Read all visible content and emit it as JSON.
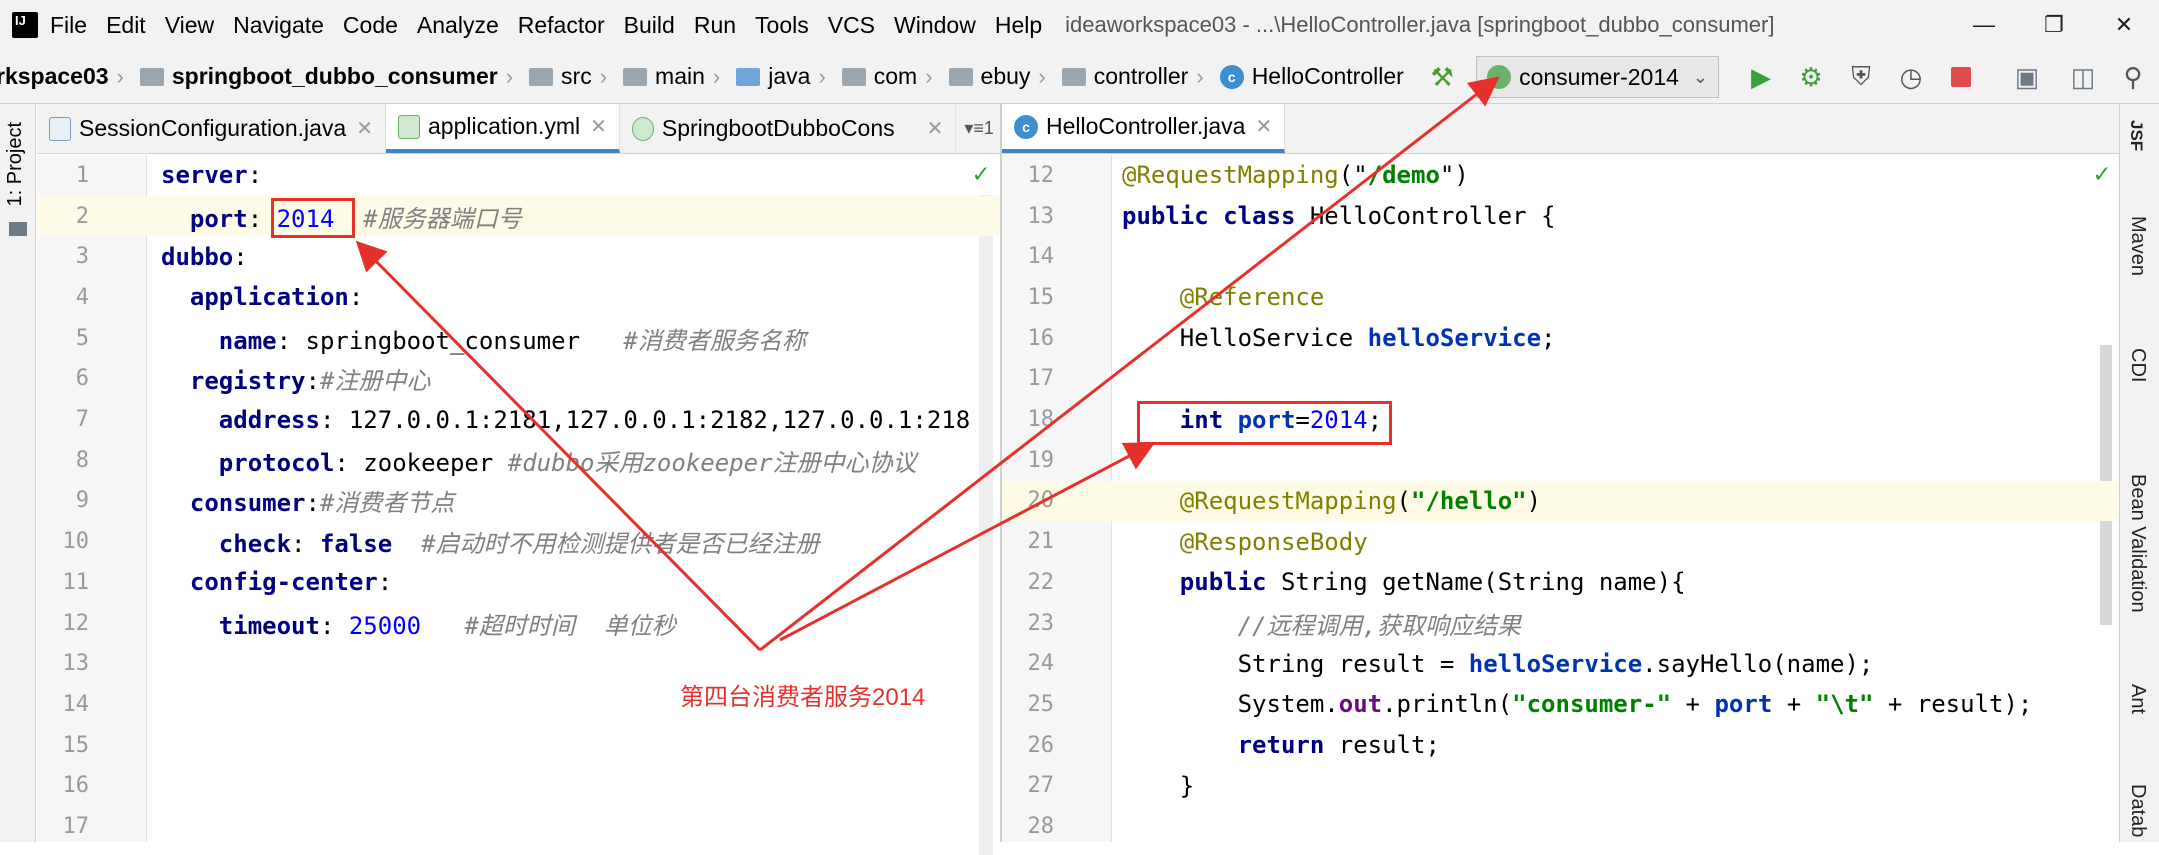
{
  "menubar": {
    "items": [
      "File",
      "Edit",
      "View",
      "Navigate",
      "Code",
      "Analyze",
      "Refactor",
      "Build",
      "Run",
      "Tools",
      "VCS",
      "Window",
      "Help"
    ],
    "title": "ideaworkspace03 - ...\\HelloController.java [springboot_dubbo_consumer]"
  },
  "navbar": {
    "crumbs": [
      "rkspace03",
      "springboot_dubbo_consumer",
      "src",
      "main",
      "java",
      "com",
      "ebuy",
      "controller",
      "HelloController"
    ],
    "run_config": "consumer-2014"
  },
  "left_tool": {
    "label": "1: Project"
  },
  "right_tools": [
    "JSF",
    "Maven",
    "CDI",
    "Bean Validation",
    "Ant",
    "Datab"
  ],
  "left_tabs": [
    "SessionConfiguration.java",
    "application.yml",
    "SpringbootDubboCons"
  ],
  "right_tabs": [
    "HelloController.java"
  ],
  "yml": {
    "line_numbers": [
      "1",
      "2",
      "3",
      "4",
      "5",
      "6",
      "7",
      "8",
      "9",
      "10",
      "11",
      "12",
      "13",
      "14",
      "15",
      "16",
      "17"
    ],
    "lines": [
      {
        "indent": "",
        "key": "server",
        "rest": ":"
      },
      {
        "indent": "  ",
        "key": "port",
        "rest": ": ",
        "num": "2014",
        "comment": "  #服务器端口号"
      },
      {
        "indent": "",
        "key": "dubbo",
        "rest": ":"
      },
      {
        "indent": "  ",
        "key": "application",
        "rest": ":"
      },
      {
        "indent": "    ",
        "key": "name",
        "rest": ": springboot_consumer   ",
        "comment": "#消费者服务名称"
      },
      {
        "indent": "  ",
        "key": "registry",
        "rest": ":",
        "comment": "#注册中心"
      },
      {
        "indent": "    ",
        "key": "address",
        "rest": ": 127.0.0.1:2181,127.0.0.1:2182,127.0.0.1:218"
      },
      {
        "indent": "    ",
        "key": "protocol",
        "rest": ": zookeeper ",
        "comment": "#dubbo采用zookeeper注册中心协议"
      },
      {
        "indent": "  ",
        "key": "consumer",
        "rest": ":",
        "comment": "#消费者节点"
      },
      {
        "indent": "    ",
        "key": "check",
        "rest": ": ",
        "kw": "false",
        "comment": "  #启动时不用检测提供者是否已经注册"
      },
      {
        "indent": "  ",
        "key": "config-center",
        "rest": ":"
      },
      {
        "indent": "    ",
        "key": "timeout",
        "rest": ": ",
        "num": "25000",
        "comment": "   #超时时间  单位秒"
      }
    ]
  },
  "java": {
    "line_numbers": [
      "12",
      "13",
      "14",
      "15",
      "16",
      "17",
      "18",
      "19",
      "20",
      "21",
      "22",
      "23",
      "24",
      "25",
      "26",
      "27",
      "28"
    ]
  },
  "annotation": {
    "label": "第四台消费者服务2014"
  }
}
